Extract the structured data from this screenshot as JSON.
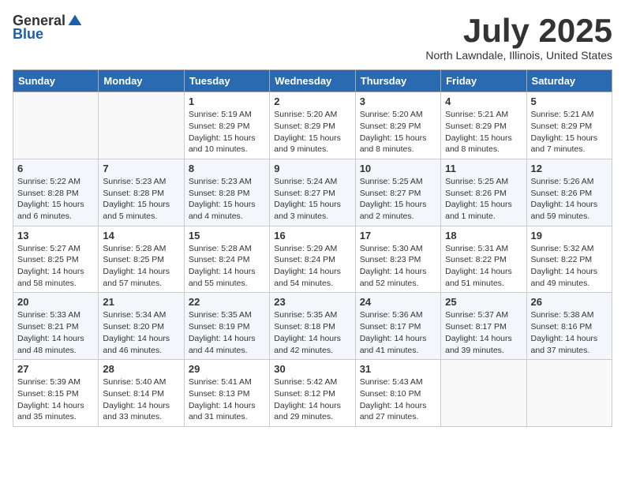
{
  "logo": {
    "general": "General",
    "blue": "Blue"
  },
  "title": "July 2025",
  "location": "North Lawndale, Illinois, United States",
  "weekdays": [
    "Sunday",
    "Monday",
    "Tuesday",
    "Wednesday",
    "Thursday",
    "Friday",
    "Saturday"
  ],
  "weeks": [
    [
      {
        "day": "",
        "info": ""
      },
      {
        "day": "",
        "info": ""
      },
      {
        "day": "1",
        "info": "Sunrise: 5:19 AM\nSunset: 8:29 PM\nDaylight: 15 hours\nand 10 minutes."
      },
      {
        "day": "2",
        "info": "Sunrise: 5:20 AM\nSunset: 8:29 PM\nDaylight: 15 hours\nand 9 minutes."
      },
      {
        "day": "3",
        "info": "Sunrise: 5:20 AM\nSunset: 8:29 PM\nDaylight: 15 hours\nand 8 minutes."
      },
      {
        "day": "4",
        "info": "Sunrise: 5:21 AM\nSunset: 8:29 PM\nDaylight: 15 hours\nand 8 minutes."
      },
      {
        "day": "5",
        "info": "Sunrise: 5:21 AM\nSunset: 8:29 PM\nDaylight: 15 hours\nand 7 minutes."
      }
    ],
    [
      {
        "day": "6",
        "info": "Sunrise: 5:22 AM\nSunset: 8:28 PM\nDaylight: 15 hours\nand 6 minutes."
      },
      {
        "day": "7",
        "info": "Sunrise: 5:23 AM\nSunset: 8:28 PM\nDaylight: 15 hours\nand 5 minutes."
      },
      {
        "day": "8",
        "info": "Sunrise: 5:23 AM\nSunset: 8:28 PM\nDaylight: 15 hours\nand 4 minutes."
      },
      {
        "day": "9",
        "info": "Sunrise: 5:24 AM\nSunset: 8:27 PM\nDaylight: 15 hours\nand 3 minutes."
      },
      {
        "day": "10",
        "info": "Sunrise: 5:25 AM\nSunset: 8:27 PM\nDaylight: 15 hours\nand 2 minutes."
      },
      {
        "day": "11",
        "info": "Sunrise: 5:25 AM\nSunset: 8:26 PM\nDaylight: 15 hours\nand 1 minute."
      },
      {
        "day": "12",
        "info": "Sunrise: 5:26 AM\nSunset: 8:26 PM\nDaylight: 14 hours\nand 59 minutes."
      }
    ],
    [
      {
        "day": "13",
        "info": "Sunrise: 5:27 AM\nSunset: 8:25 PM\nDaylight: 14 hours\nand 58 minutes."
      },
      {
        "day": "14",
        "info": "Sunrise: 5:28 AM\nSunset: 8:25 PM\nDaylight: 14 hours\nand 57 minutes."
      },
      {
        "day": "15",
        "info": "Sunrise: 5:28 AM\nSunset: 8:24 PM\nDaylight: 14 hours\nand 55 minutes."
      },
      {
        "day": "16",
        "info": "Sunrise: 5:29 AM\nSunset: 8:24 PM\nDaylight: 14 hours\nand 54 minutes."
      },
      {
        "day": "17",
        "info": "Sunrise: 5:30 AM\nSunset: 8:23 PM\nDaylight: 14 hours\nand 52 minutes."
      },
      {
        "day": "18",
        "info": "Sunrise: 5:31 AM\nSunset: 8:22 PM\nDaylight: 14 hours\nand 51 minutes."
      },
      {
        "day": "19",
        "info": "Sunrise: 5:32 AM\nSunset: 8:22 PM\nDaylight: 14 hours\nand 49 minutes."
      }
    ],
    [
      {
        "day": "20",
        "info": "Sunrise: 5:33 AM\nSunset: 8:21 PM\nDaylight: 14 hours\nand 48 minutes."
      },
      {
        "day": "21",
        "info": "Sunrise: 5:34 AM\nSunset: 8:20 PM\nDaylight: 14 hours\nand 46 minutes."
      },
      {
        "day": "22",
        "info": "Sunrise: 5:35 AM\nSunset: 8:19 PM\nDaylight: 14 hours\nand 44 minutes."
      },
      {
        "day": "23",
        "info": "Sunrise: 5:35 AM\nSunset: 8:18 PM\nDaylight: 14 hours\nand 42 minutes."
      },
      {
        "day": "24",
        "info": "Sunrise: 5:36 AM\nSunset: 8:17 PM\nDaylight: 14 hours\nand 41 minutes."
      },
      {
        "day": "25",
        "info": "Sunrise: 5:37 AM\nSunset: 8:17 PM\nDaylight: 14 hours\nand 39 minutes."
      },
      {
        "day": "26",
        "info": "Sunrise: 5:38 AM\nSunset: 8:16 PM\nDaylight: 14 hours\nand 37 minutes."
      }
    ],
    [
      {
        "day": "27",
        "info": "Sunrise: 5:39 AM\nSunset: 8:15 PM\nDaylight: 14 hours\nand 35 minutes."
      },
      {
        "day": "28",
        "info": "Sunrise: 5:40 AM\nSunset: 8:14 PM\nDaylight: 14 hours\nand 33 minutes."
      },
      {
        "day": "29",
        "info": "Sunrise: 5:41 AM\nSunset: 8:13 PM\nDaylight: 14 hours\nand 31 minutes."
      },
      {
        "day": "30",
        "info": "Sunrise: 5:42 AM\nSunset: 8:12 PM\nDaylight: 14 hours\nand 29 minutes."
      },
      {
        "day": "31",
        "info": "Sunrise: 5:43 AM\nSunset: 8:10 PM\nDaylight: 14 hours\nand 27 minutes."
      },
      {
        "day": "",
        "info": ""
      },
      {
        "day": "",
        "info": ""
      }
    ]
  ]
}
